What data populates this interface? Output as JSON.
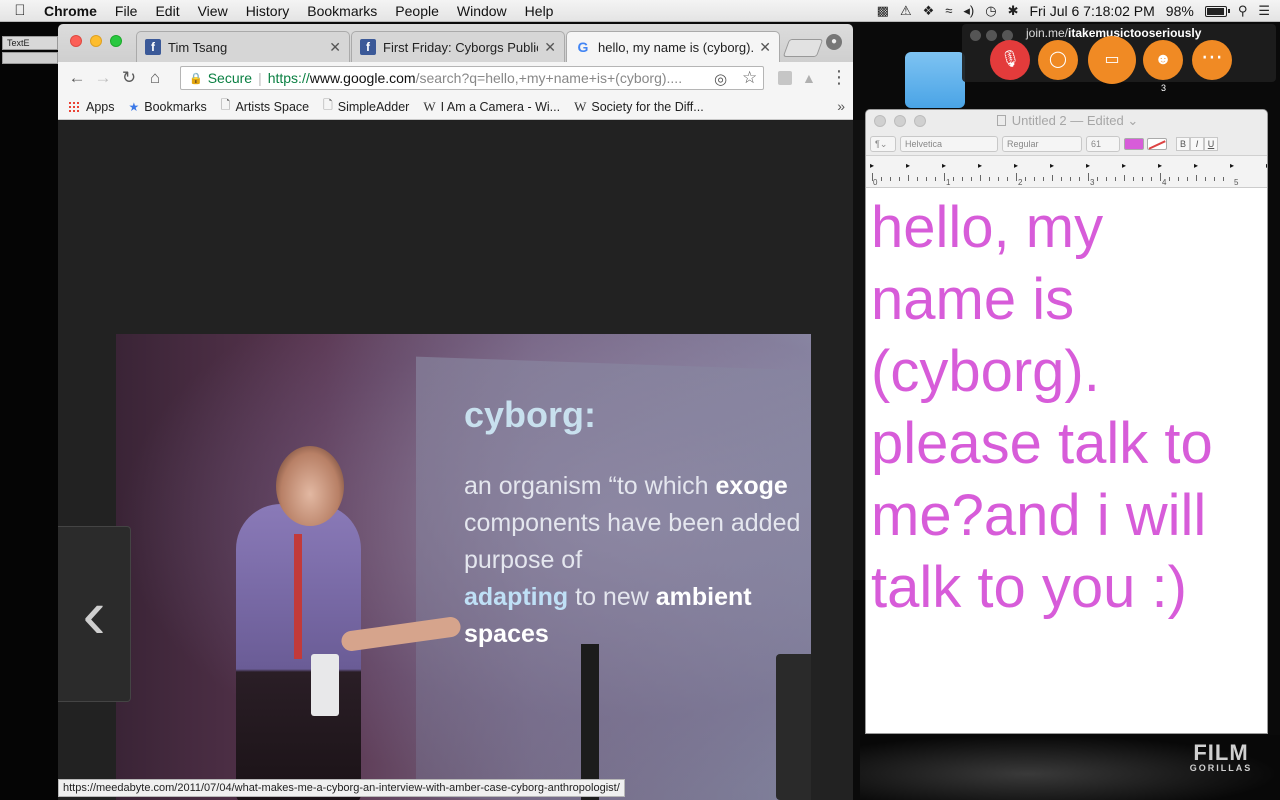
{
  "menubar": {
    "app": "Chrome",
    "items": [
      "File",
      "Edit",
      "View",
      "History",
      "Bookmarks",
      "People",
      "Window",
      "Help"
    ],
    "battery": "98%",
    "datetime": "Fri Jul 6  7:18:02 PM"
  },
  "background": {
    "textedit_tab": "TextE",
    "logo_line1": "FILM",
    "logo_line2": "GORILLAS"
  },
  "chrome": {
    "tabs": [
      {
        "title": "Tim Tsang",
        "favicon": "facebook-icon"
      },
      {
        "title": "First Friday: Cyborgs Publica",
        "favicon": "facebook-icon"
      },
      {
        "title": "hello, my name is (cyborg). p",
        "favicon": "google-icon"
      }
    ],
    "omnibox": {
      "secure_label": "Secure",
      "scheme": "https://",
      "host": "www.google.com",
      "path": "/search?q=hello,+my+name+is+(cyborg)...."
    },
    "bookmarks": [
      {
        "label": "Apps",
        "icon": "apps-grid-icon"
      },
      {
        "label": "Bookmarks",
        "icon": "star-icon"
      },
      {
        "label": "Artists Space",
        "icon": "page-icon"
      },
      {
        "label": "SimpleAdder",
        "icon": "page-icon"
      },
      {
        "label": "I Am a Camera - Wi...",
        "icon": "wikipedia-icon"
      },
      {
        "label": "Society for the Diff...",
        "icon": "wikipedia-icon"
      }
    ],
    "slide": {
      "title": "cyborg:",
      "line1_a": "an organism ",
      "line1_b": "“to which ",
      "line1_c": "exoge",
      "line2": "components have been added",
      "line3": "purpose of",
      "line4_a": "adapting",
      "line4_b": " to new ",
      "line4_c": "ambient",
      "line5": "spaces"
    },
    "status_url": "https://meedabyte.com/2011/07/04/what-makes-me-a-cyborg-an-interview-with-amber-case-cyborg-anthropologist/"
  },
  "joinme": {
    "url_prefix": "join.me/",
    "url_name": "itakemusictooseriously",
    "participant_count": "3"
  },
  "textedit": {
    "title": "Untitled 2",
    "edited": "— Edited",
    "font": "Helvetica",
    "style": "Regular",
    "size": "61",
    "ruler_numbers": [
      "0",
      "1",
      "2",
      "3",
      "4",
      "5"
    ],
    "text": "hello, my name is (cyborg). please talk to me?and i will talk to you :)",
    "text_color": "#d75cd9"
  },
  "colors": {
    "accent_secure": "#0b8043",
    "joinme_orange": "#f08a24",
    "joinme_mic_red": "#e33b3b"
  }
}
